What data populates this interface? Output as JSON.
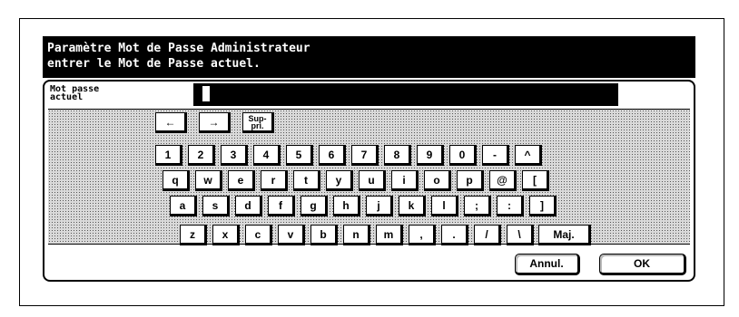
{
  "dialog": {
    "title_line1": "Paramètre Mot de Passe Administrateur",
    "title_line2": "entrer le Mot de Passe actuel.",
    "field_label": "Mot passe\nactuel"
  },
  "keyboard": {
    "nav": {
      "left_arrow": "←",
      "right_arrow": "→",
      "delete_line1": "Sup-",
      "delete_line2": "pri."
    },
    "row1": [
      "1",
      "2",
      "3",
      "4",
      "5",
      "6",
      "7",
      "8",
      "9",
      "0",
      "-",
      "^"
    ],
    "row2": [
      "q",
      "w",
      "e",
      "r",
      "t",
      "y",
      "u",
      "i",
      "o",
      "p",
      "@",
      "["
    ],
    "row3": [
      "a",
      "s",
      "d",
      "f",
      "g",
      "h",
      "j",
      "k",
      "l",
      ";",
      ":",
      "]"
    ],
    "row4": [
      "z",
      "x",
      "c",
      "v",
      "b",
      "n",
      "m",
      ",",
      ".",
      "/",
      "\\"
    ],
    "shift_label": "Maj."
  },
  "actions": {
    "cancel_label": "Annul.",
    "ok_label": "OK"
  }
}
